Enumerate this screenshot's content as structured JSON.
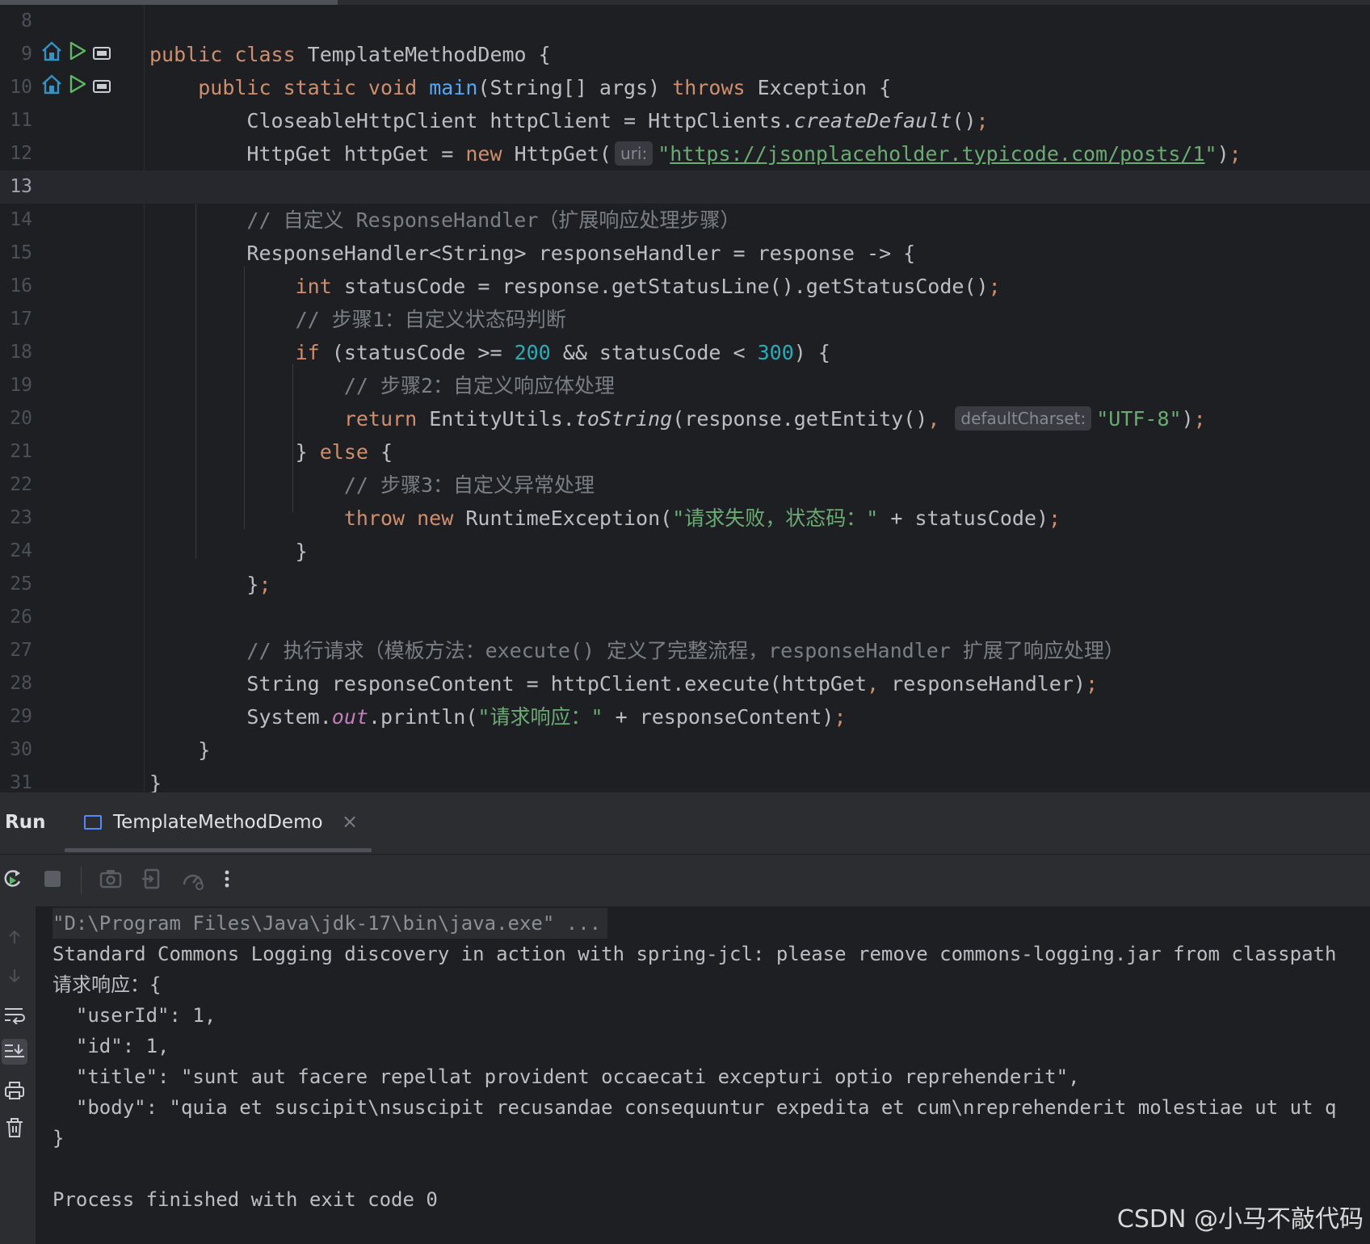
{
  "editor": {
    "lines": [
      {
        "n": "8",
        "html": ""
      },
      {
        "n": "9",
        "icons": true,
        "html": "<span class=\"kw\">public class </span>TemplateMethodDemo {"
      },
      {
        "n": "10",
        "icons": true,
        "html": "    <span class=\"kw\">public static void </span><span class=\"fn\">main</span>(String[] args) <span class=\"kw\">throws </span>Exception {"
      },
      {
        "n": "11",
        "html": "        CloseableHttpClient httpClient = HttpClients.<span class=\"it\">createDefault</span>()<span class=\"kw\">;</span>"
      },
      {
        "n": "12",
        "html": "        HttpGet httpGet = <span class=\"kw\">new </span>HttpGet(<span class=\"hint\">uri:</span><span class=\"st\">\"<span class=\"url\">https://jsonplaceholder.typicode.com/posts/1</span>\"</span>)<span class=\"kw\">;</span>"
      },
      {
        "n": "13",
        "current": true,
        "html": ""
      },
      {
        "n": "14",
        "html": "        <span class=\"cm\">// 自定义 ResponseHandler（扩展响应处理步骤）</span>"
      },
      {
        "n": "15",
        "html": "        ResponseHandler&lt;String&gt; responseHandler = response -&gt; {"
      },
      {
        "n": "16",
        "html": "            <span class=\"kw\">int </span>statusCode = response.getStatusLine().getStatusCode()<span class=\"kw\">;</span>"
      },
      {
        "n": "17",
        "html": "            <span class=\"cm\">// 步骤1：自定义状态码判断</span>"
      },
      {
        "n": "18",
        "html": "            <span class=\"kw\">if </span>(statusCode &gt;= <span class=\"num\">200 </span>&amp;&amp; statusCode &lt; <span class=\"num\">300</span>) {"
      },
      {
        "n": "19",
        "html": "                <span class=\"cm\">// 步骤2：自定义响应体处理</span>"
      },
      {
        "n": "20",
        "html": "                <span class=\"kw\">return </span>EntityUtils.<span class=\"it\">toString</span>(response.getEntity()<span class=\"kw\">, </span><span class=\"hint\">defaultCharset:</span><span class=\"st\">\"UTF-8\"</span>)<span class=\"kw\">;</span>"
      },
      {
        "n": "21",
        "html": "            } <span class=\"kw\">else </span>{"
      },
      {
        "n": "22",
        "html": "                <span class=\"cm\">// 步骤3：自定义异常处理</span>"
      },
      {
        "n": "23",
        "html": "                <span class=\"kw\">throw new </span>RuntimeException(<span class=\"st\">\"请求失败，状态码：\" </span>+ statusCode)<span class=\"kw\">;</span>"
      },
      {
        "n": "24",
        "html": "            }"
      },
      {
        "n": "25",
        "html": "        }<span class=\"kw\">;</span>"
      },
      {
        "n": "26",
        "html": ""
      },
      {
        "n": "27",
        "html": "        <span class=\"cm\">// 执行请求（模板方法：execute() 定义了完整流程，responseHandler 扩展了响应处理）</span>"
      },
      {
        "n": "28",
        "html": "        String responseContent = httpClient.execute(httpGet<span class=\"kw\">, </span>responseHandler)<span class=\"kw\">;</span>"
      },
      {
        "n": "29",
        "html": "        System.<span class=\"fld\">out</span>.println(<span class=\"st\">\"请求响应：\" </span>+ responseContent)<span class=\"kw\">;</span>"
      },
      {
        "n": "30",
        "html": "    }"
      },
      {
        "n": "31",
        "html": "}"
      }
    ]
  },
  "run_panel": {
    "label": "Run",
    "tab_title": "TemplateMethodDemo",
    "close_glyph": "×",
    "console": [
      {
        "text": "\"D:\\Program Files\\Java\\jdk-17\\bin\\java.exe\" ...",
        "cmd": true
      },
      {
        "text": "Standard Commons Logging discovery in action with spring-jcl: please remove commons-logging.jar from classpath"
      },
      {
        "text": "请求响应：{"
      },
      {
        "text": "  \"userId\": 1,"
      },
      {
        "text": "  \"id\": 1,"
      },
      {
        "text": "  \"title\": \"sunt aut facere repellat provident occaecati excepturi optio reprehenderit\","
      },
      {
        "text": "  \"body\": \"quia et suscipit\\nsuscipit recusandae consequuntur expedita et cum\\nreprehenderit molestiae ut ut q"
      },
      {
        "text": "}"
      },
      {
        "text": ""
      },
      {
        "text": "Process finished with exit code 0"
      }
    ]
  },
  "watermark": "CSDN @小马不敲代码",
  "colors": {
    "keyword": "#cf8e6d",
    "string": "#6aab73",
    "number": "#2aacb8",
    "comment": "#7a7e85",
    "function": "#56a8f5",
    "accent": "#548af7"
  },
  "icons": [
    "run-gutter-icon",
    "debug-gutter-icon",
    "rerun-icon",
    "stop-icon",
    "screenshot-icon",
    "export-icon",
    "profiler-icon",
    "more-icon",
    "up-arrow-icon",
    "down-arrow-icon",
    "soft-wrap-icon",
    "scroll-to-end-icon",
    "print-icon",
    "trash-icon",
    "close-icon"
  ]
}
